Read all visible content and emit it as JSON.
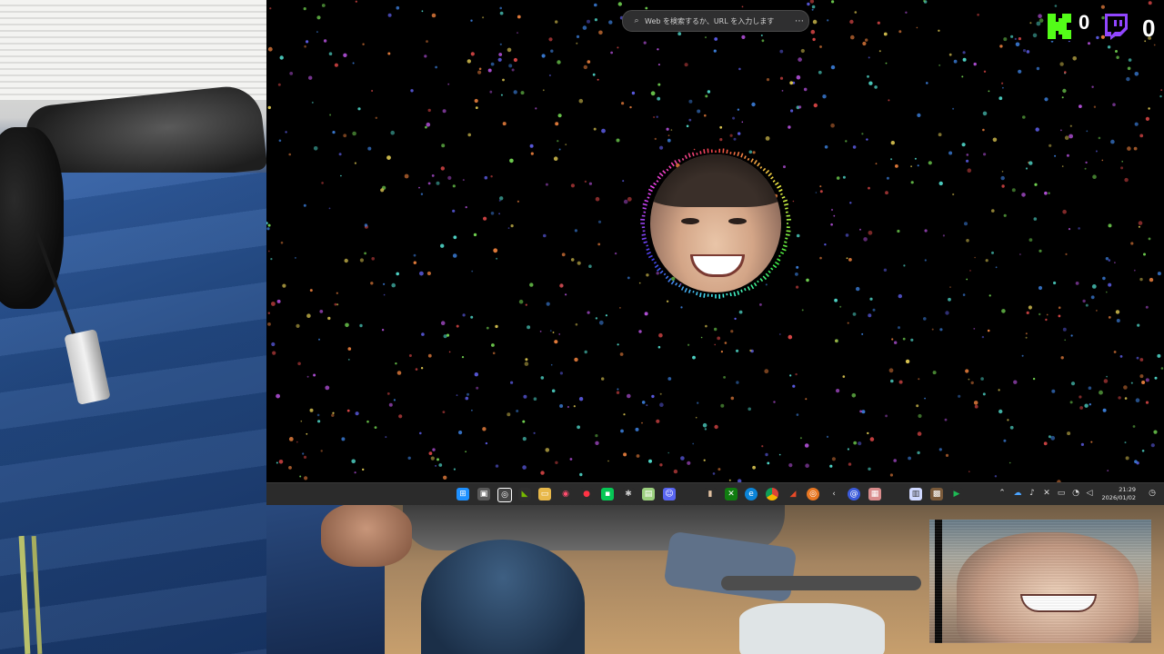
{
  "browser": {
    "address_placeholder": "Web を検索するか、URL を入力します",
    "search_icon": "search-icon",
    "more_icon": "more-icon"
  },
  "overlay": {
    "kick_count": "0",
    "twitch_count": "0",
    "kick_color": "#53fc18",
    "twitch_color": "#9146ff"
  },
  "taskbar": {
    "clock_time": "21:29",
    "clock_date": "2026/01/02",
    "start_icon": "windows-start-icon"
  }
}
